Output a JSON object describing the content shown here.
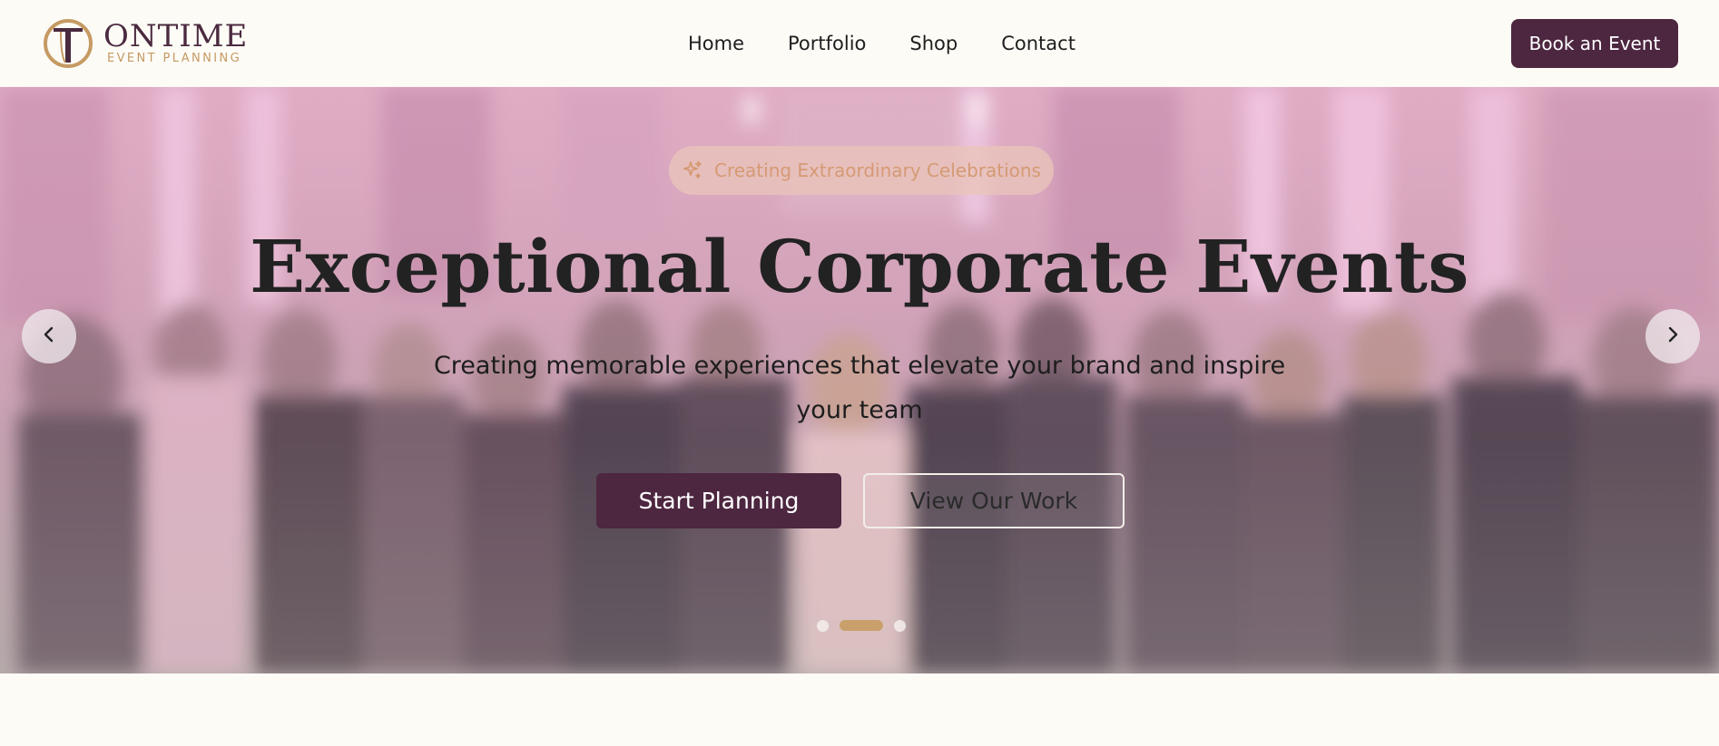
{
  "logo": {
    "name": "ONTIME",
    "subtitle": "EVENT PLANNING"
  },
  "nav": {
    "items": [
      {
        "label": "Home"
      },
      {
        "label": "Portfolio"
      },
      {
        "label": "Shop"
      },
      {
        "label": "Contact"
      }
    ],
    "cta_label": "Book an Event"
  },
  "hero": {
    "badge_text": "Creating Extraordinary Celebrations",
    "title": "Exceptional Corporate Events",
    "subtitle": "Creating memorable experiences that elevate your brand and inspire your team",
    "primary_button": "Start Planning",
    "secondary_button": "View Our Work",
    "slides_total": 3,
    "active_slide": 2
  },
  "colors": {
    "brand_plum": "#4d2640",
    "brand_gold": "#c59a63",
    "page_bg": "#fdfbf6"
  },
  "icons": {
    "badge": "sparkles-icon",
    "prev": "chevron-left-icon",
    "next": "chevron-right-icon"
  }
}
